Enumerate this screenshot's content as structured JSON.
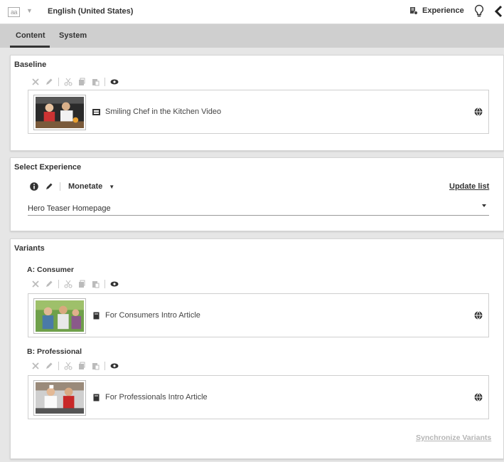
{
  "header": {
    "language_icon": "language-icon",
    "language": "English (United States)",
    "experience_label": "Experience"
  },
  "tabs": [
    {
      "label": "Content",
      "active": true
    },
    {
      "label": "System",
      "active": false
    }
  ],
  "baseline": {
    "title": "Baseline",
    "item": {
      "title": "Smiling Chef in the Kitchen Video",
      "type_icon": "film-icon"
    }
  },
  "select_experience": {
    "title": "Select Experience",
    "provider": "Monetate",
    "update_label": "Update list",
    "selected": "Hero Teaser Homepage"
  },
  "variants": {
    "title": "Variants",
    "items": [
      {
        "label": "A: Consumer",
        "title": "For Consumers Intro Article",
        "type_icon": "article-icon"
      },
      {
        "label": "B: Professional",
        "title": "For Professionals Intro Article",
        "type_icon": "article-icon"
      }
    ],
    "sync_label": "Synchronize Variants"
  },
  "colors": {
    "accent": "#333333",
    "disabled": "#bbbbbb",
    "tab_bar": "#cfcfcf"
  }
}
